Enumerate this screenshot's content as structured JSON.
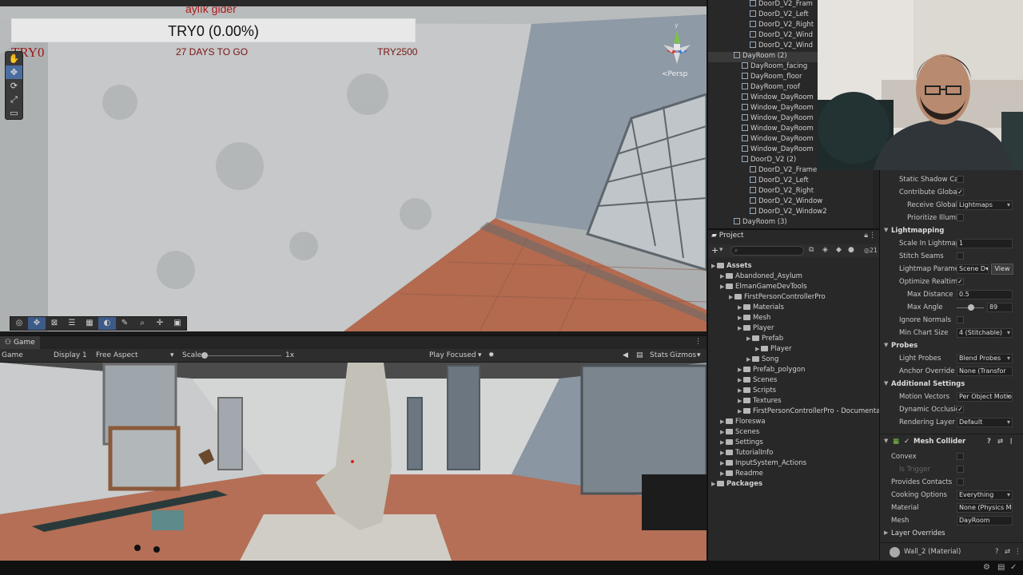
{
  "hud": {
    "top_label": "aylık gider",
    "progress_text": "TRY0 (0.00%)",
    "left_amount": "TRY0",
    "days_to_go": "27 DAYS TO GO",
    "right_amount": "TRY2500"
  },
  "scene": {
    "persp_label": "<Persp",
    "gizmo_y": "y",
    "tools": [
      "✋",
      "✥",
      "⟳",
      "⤢",
      "▭",
      "⚙"
    ]
  },
  "game": {
    "tab_label": "Game",
    "toolbar": {
      "game_dropdown": "Game",
      "display": "Display 1",
      "aspect": "Free Aspect",
      "scale_label": "Scale",
      "scale_value": "1x",
      "play_focused": "Play Focused",
      "stats": "Stats",
      "gizmos": "Gizmos"
    }
  },
  "hierarchy": {
    "items": [
      {
        "label": "DoorD_V2_Fram",
        "indent": 4
      },
      {
        "label": "DoorD_V2_Left",
        "indent": 4
      },
      {
        "label": "DoorD_V2_Right",
        "indent": 4
      },
      {
        "label": "DoorD_V2_Wind",
        "indent": 4
      },
      {
        "label": "DoorD_V2_Wind",
        "indent": 4
      },
      {
        "label": "DayRoom (2)",
        "indent": 2
      },
      {
        "label": "DayRoom_facing",
        "indent": 3
      },
      {
        "label": "DayRoom_floor",
        "indent": 3
      },
      {
        "label": "DayRoom_roof",
        "indent": 3
      },
      {
        "label": "Window_DayRoom",
        "indent": 3
      },
      {
        "label": "Window_DayRoom",
        "indent": 3
      },
      {
        "label": "Window_DayRoom",
        "indent": 3
      },
      {
        "label": "Window_DayRoom",
        "indent": 3
      },
      {
        "label": "Window_DayRoom",
        "indent": 3
      },
      {
        "label": "Window_DayRoom",
        "indent": 3
      },
      {
        "label": "DoorD_V2 (2)",
        "indent": 3
      },
      {
        "label": "DoorD_V2_Frame",
        "indent": 4
      },
      {
        "label": "DoorD_V2_Left",
        "indent": 4
      },
      {
        "label": "DoorD_V2_Right",
        "indent": 4
      },
      {
        "label": "DoorD_V2_Window",
        "indent": 4
      },
      {
        "label": "DoorD_V2_Window2",
        "indent": 4
      },
      {
        "label": "DayRoom (3)",
        "indent": 2
      }
    ]
  },
  "project": {
    "tab_label": "Project",
    "count": "21",
    "items": [
      {
        "label": "Assets",
        "indent": 0,
        "bold": true
      },
      {
        "label": "Abandoned_Asylum",
        "indent": 1
      },
      {
        "label": "ElmanGameDevTools",
        "indent": 1
      },
      {
        "label": "FirstPersonControllerPro",
        "indent": 2
      },
      {
        "label": "Materials",
        "indent": 3
      },
      {
        "label": "Mesh",
        "indent": 3
      },
      {
        "label": "Player",
        "indent": 3
      },
      {
        "label": "Prefab",
        "indent": 4
      },
      {
        "label": "Player",
        "indent": 5
      },
      {
        "label": "Song",
        "indent": 4
      },
      {
        "label": "Prefab_polygon",
        "indent": 3
      },
      {
        "label": "Scenes",
        "indent": 3
      },
      {
        "label": "Scripts",
        "indent": 3
      },
      {
        "label": "Textures",
        "indent": 3
      },
      {
        "label": "FirstPersonControllerPro - Documentation",
        "indent": 3
      },
      {
        "label": "Floreswa",
        "indent": 1
      },
      {
        "label": "Scenes",
        "indent": 1
      },
      {
        "label": "Settings",
        "indent": 1
      },
      {
        "label": "TutorialInfo",
        "indent": 1
      },
      {
        "label": "InputSystem_Actions",
        "indent": 1
      },
      {
        "label": "Readme",
        "indent": 1
      },
      {
        "label": "Packages",
        "indent": 0,
        "bold": true
      }
    ]
  },
  "inspector": {
    "static_shadow": "Static Shadow Cas",
    "contribute_gi": "Contribute Global",
    "receive_gi": "Receive Global I",
    "receive_gi_value": "Lightmaps",
    "prioritize": "Prioritize Illumin",
    "lightmapping_header": "Lightmapping",
    "scale_in_lightmap": "Scale In Lightmap",
    "scale_in_lightmap_value": "1",
    "stitch_seams": "Stitch Seams",
    "lightmap_params": "Lightmap Paramet",
    "lightmap_params_value": "Scene D▾",
    "view_button": "View",
    "optimize_realtime": "Optimize Realtime",
    "max_distance": "Max Distance",
    "max_distance_value": "0.5",
    "max_angle": "Max Angle",
    "max_angle_value": "89",
    "ignore_normals": "Ignore Normals",
    "min_chart_size": "Min Chart Size",
    "min_chart_size_value": "4 (Stitchable)",
    "probes_header": "Probes",
    "light_probes": "Light Probes",
    "light_probes_value": "Blend Probes",
    "anchor_override": "Anchor Override",
    "anchor_override_value": "None (Transfor",
    "additional_header": "Additional Settings",
    "motion_vectors": "Motion Vectors",
    "motion_vectors_value": "Per Object Motio",
    "dynamic_occlusion": "Dynamic Occlusio",
    "rendering_layer": "Rendering Layer M",
    "rendering_layer_value": "Default",
    "mesh_collider_header": "Mesh Collider",
    "convex": "Convex",
    "is_trigger": "Is Trigger",
    "provides_contacts": "Provides Contacts",
    "cooking_options": "Cooking Options",
    "cooking_options_value": "Everything",
    "material": "Material",
    "material_value": "None (Physics M",
    "mesh": "Mesh",
    "mesh_value": "DayRoom",
    "layer_overrides": "Layer Overrides",
    "wall_material": "Wall_2 (Material)"
  }
}
